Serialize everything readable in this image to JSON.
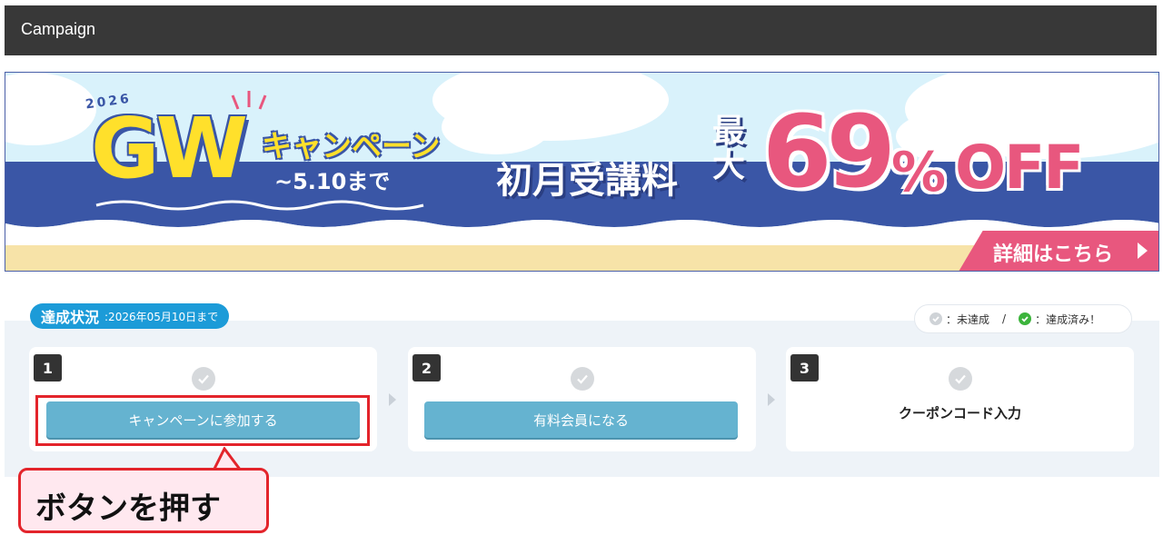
{
  "header": {
    "title": "Campaign"
  },
  "banner": {
    "year": "2026",
    "gw": "GW",
    "campaign": "キャンペーン",
    "until": "~5.10まで",
    "first_month": "初月受講料",
    "max": "最大",
    "number": "69",
    "percent": "%",
    "off": "OFF",
    "details_link": "詳細はこちら",
    "colors": {
      "navy": "#3a56a6",
      "yellow": "#ffe02b",
      "pink": "#e8577e"
    }
  },
  "progress": {
    "status_label": "達成状況",
    "deadline": ":2026年05月10日まで",
    "legend": {
      "incomplete": "：未達成",
      "separator": "/",
      "complete": "：達成済み！"
    },
    "steps": [
      {
        "number": "1",
        "button_label": "キャンペーンに参加する",
        "check_icon": "check-circle-icon",
        "done": false
      },
      {
        "number": "2",
        "button_label": "有料会員になる",
        "check_icon": "check-circle-icon",
        "done": false
      },
      {
        "number": "3",
        "text": "クーポンコード入力",
        "check_icon": "check-circle-icon",
        "done": false
      }
    ]
  },
  "annotation": {
    "callout_text": "ボタンを押す"
  }
}
